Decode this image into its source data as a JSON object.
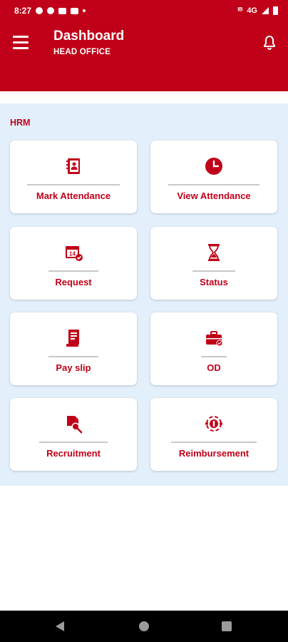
{
  "status_bar": {
    "time": "8:27",
    "network": "4G",
    "signal_text": "ᴵᴮ"
  },
  "app_bar": {
    "title": "Dashboard",
    "subtitle": "HEAD OFFICE"
  },
  "section": {
    "label": "HRM"
  },
  "cards": [
    {
      "label": "Mark Attendance",
      "icon": "contact-book-icon"
    },
    {
      "label": "View Attendance",
      "icon": "clock-icon"
    },
    {
      "label": "Request",
      "icon": "calendar-check-icon"
    },
    {
      "label": "Status",
      "icon": "hourglass-icon"
    },
    {
      "label": "Pay slip",
      "icon": "receipt-icon"
    },
    {
      "label": "OD",
      "icon": "briefcase-check-icon"
    },
    {
      "label": "Recruitment",
      "icon": "document-search-icon"
    },
    {
      "label": "Reimbursement",
      "icon": "money-target-icon"
    }
  ],
  "colors": {
    "brand": "#c00018",
    "content_bg": "#e3effb"
  }
}
